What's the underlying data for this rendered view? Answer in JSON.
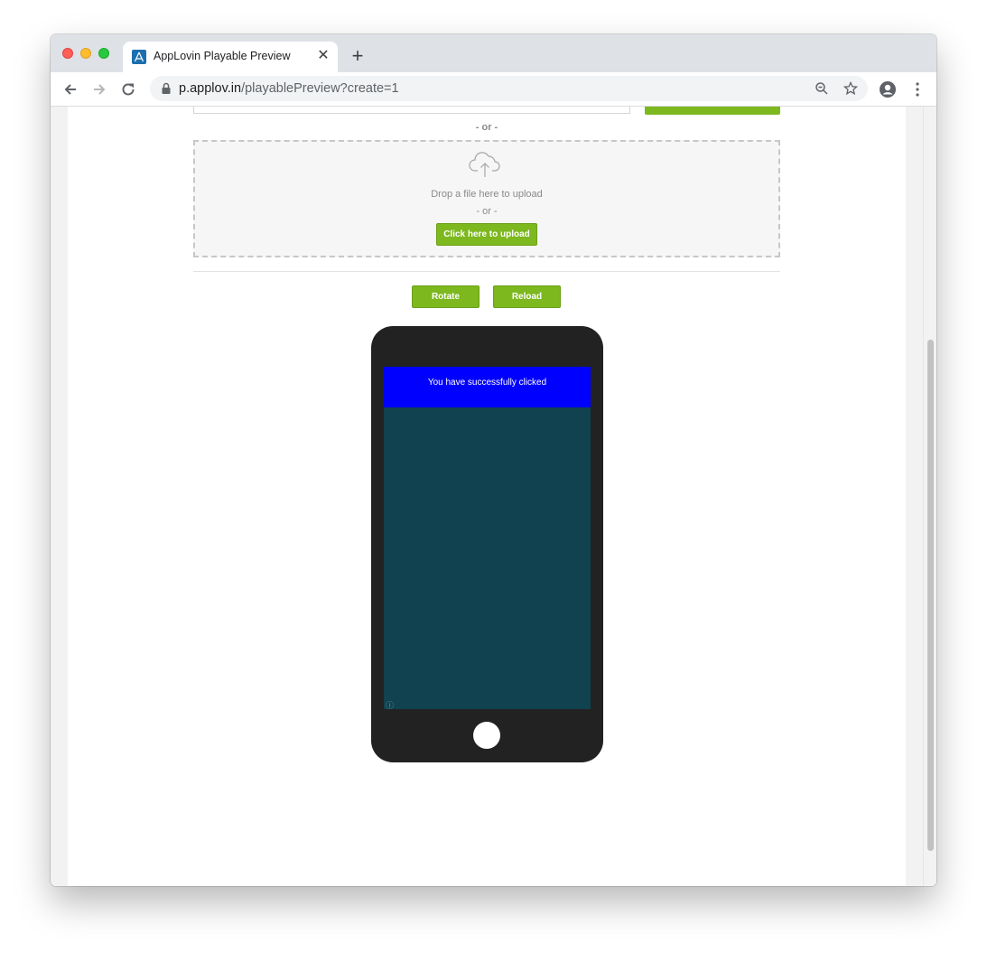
{
  "browser": {
    "tab_title": "AppLovin Playable Preview",
    "tab_close": "✕",
    "new_tab": "+",
    "url_host": "p.applov.in",
    "url_path": "/playablePreview?create=1"
  },
  "page": {
    "or_top": "- or -",
    "drop_text": "Drop a file here to upload",
    "drop_or": "- or -",
    "upload_button": "Click here to upload",
    "rotate_button": "Rotate",
    "reload_button": "Reload"
  },
  "phone": {
    "banner_text": "You have successfully clicked",
    "info_icon": "ⓘ",
    "screen_color": "#11424f",
    "banner_color": "#0000ff"
  },
  "colors": {
    "accent_green": "#7cb81e"
  }
}
